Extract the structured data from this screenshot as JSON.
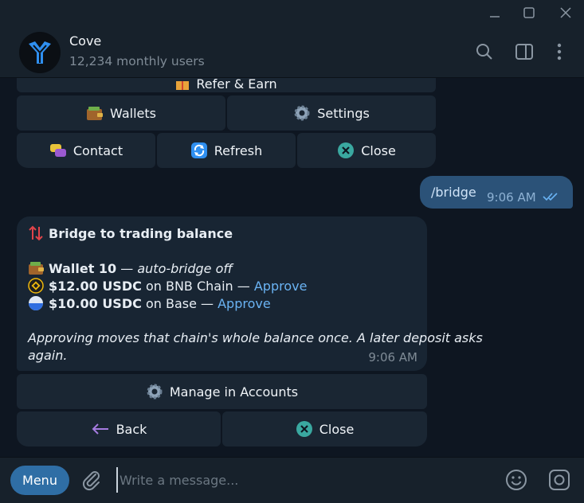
{
  "header": {
    "name": "Cove",
    "subtitle": "12,234 monthly users"
  },
  "keyboard_top": {
    "refer_partial": "Refer & Earn",
    "wallets": "Wallets",
    "settings": "Settings",
    "contact": "Contact",
    "refresh": "Refresh",
    "close": "Close"
  },
  "outgoing": {
    "text": "/bridge",
    "time": "9:06 AM"
  },
  "incoming": {
    "title": "Bridge to trading balance",
    "wallet_name": "Wallet 10",
    "wallet_sep": " — ",
    "wallet_status": "auto-bridge off",
    "line1_amount": "$12.00 USDC",
    "line1_chain": " on BNB Chain — ",
    "line1_link": "Approve",
    "line2_amount": "$10.00 USDC",
    "line2_chain": " on Base — ",
    "line2_link": "Approve",
    "note_line1": "Approving moves that chain's whole balance once. A later deposit asks",
    "note_line2": "again.",
    "time": "9:06 AM"
  },
  "keyboard_bottom": {
    "manage": "Manage in Accounts",
    "back": "Back",
    "close": "Close"
  },
  "input": {
    "menu_label": "Menu",
    "placeholder": "Write a message..."
  },
  "colors": {
    "background": "#0e1621",
    "panel": "#17212b",
    "outgoing_bubble": "#2b5278",
    "incoming_bubble": "#182533",
    "link": "#6ab3f3",
    "menu_button": "#2f6ea5"
  }
}
